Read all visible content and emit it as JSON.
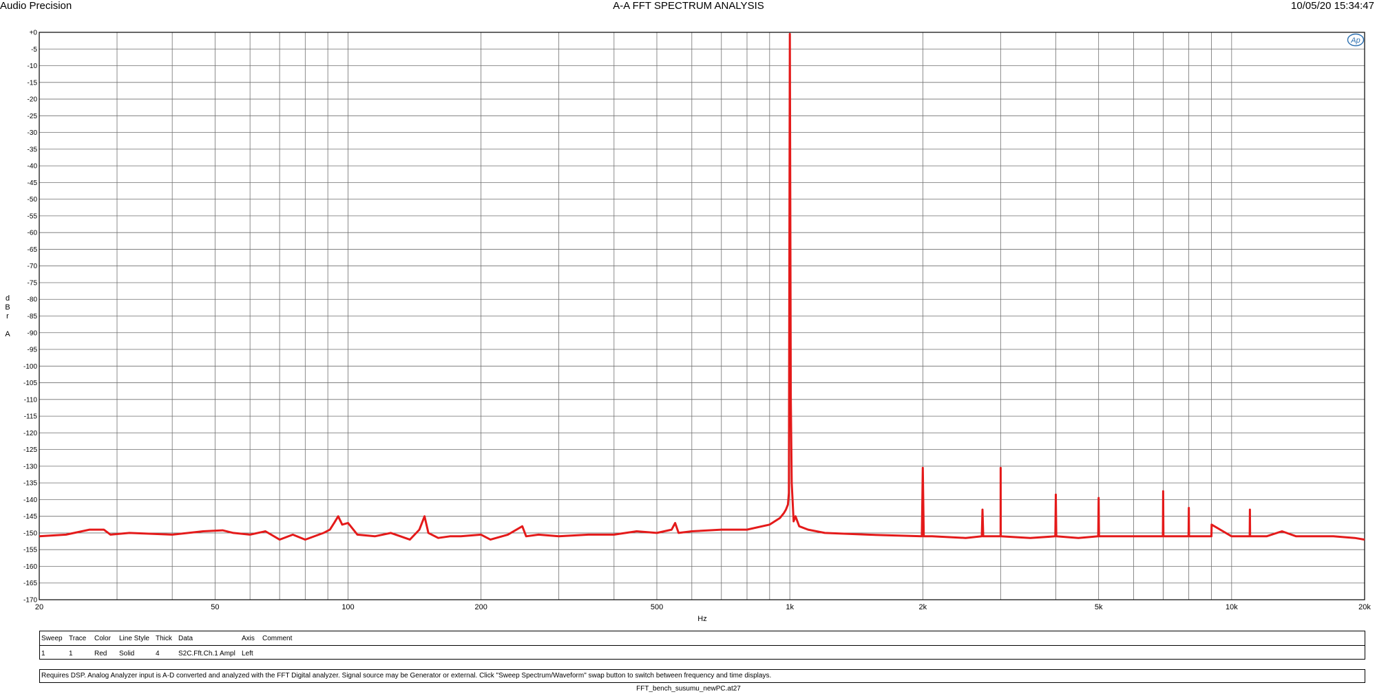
{
  "header": {
    "left": "Audio Precision",
    "center": "A-A FFT SPECTRUM ANALYSIS",
    "right": "10/05/20 15:34:47"
  },
  "chart_data": {
    "type": "line",
    "xscale": "log",
    "xlim": [
      20,
      20000
    ],
    "ylim": [
      -170,
      0
    ],
    "xlabel": "Hz",
    "ylabel": [
      "d",
      "B",
      "r",
      "",
      "A"
    ],
    "grid": true,
    "xticks": [
      {
        "v": 20,
        "t": "20"
      },
      {
        "v": 50,
        "t": "50"
      },
      {
        "v": 100,
        "t": "100"
      },
      {
        "v": 200,
        "t": "200"
      },
      {
        "v": 500,
        "t": "500"
      },
      {
        "v": 1000,
        "t": "1k"
      },
      {
        "v": 2000,
        "t": "2k"
      },
      {
        "v": 5000,
        "t": "5k"
      },
      {
        "v": 10000,
        "t": "10k"
      },
      {
        "v": 20000,
        "t": "20k"
      }
    ],
    "yticks": [
      "+0",
      "-5",
      "-10",
      "-15",
      "-20",
      "-25",
      "-30",
      "-35",
      "-40",
      "-45",
      "-50",
      "-55",
      "-60",
      "-65",
      "-70",
      "-75",
      "-80",
      "-85",
      "-90",
      "-95",
      "-100",
      "-105",
      "-110",
      "-115",
      "-120",
      "-125",
      "-130",
      "-135",
      "-140",
      "-145",
      "-150",
      "-155",
      "-160",
      "-165",
      "-170"
    ],
    "series": [
      {
        "color": "#e41a1a",
        "x": [
          20,
          23,
          26,
          28,
          29,
          32,
          40,
          47,
          52,
          55,
          60,
          65,
          70,
          75,
          80,
          88,
          91,
          93,
          95,
          97,
          100,
          105,
          115,
          125,
          138,
          145,
          149,
          152,
          160,
          170,
          180,
          200,
          210,
          230,
          248,
          253,
          270,
          300,
          350,
          400,
          450,
          500,
          540,
          550,
          560,
          600,
          700,
          800,
          900,
          950,
          970,
          980,
          990,
          995,
          1000,
          1005,
          1010,
          1020,
          1030,
          1050,
          1100,
          1200,
          1500,
          1990,
          2000,
          2010,
          2100,
          2500,
          2720,
          2730,
          2740,
          3000,
          3001,
          3002,
          3500,
          3990,
          4000,
          4010,
          4500,
          4990,
          5000,
          5010,
          5500,
          6000,
          6990,
          7000,
          7010,
          7500,
          7990,
          8000,
          8010,
          9000,
          9010,
          10000,
          10990,
          11000,
          11010,
          12000,
          13000,
          14000,
          17000,
          19000,
          20000
        ],
        "y": [
          -151,
          -150.5,
          -149,
          -149,
          -150.5,
          -150,
          -150.5,
          -149.5,
          -149.2,
          -150,
          -150.5,
          -149.5,
          -152,
          -150.5,
          -152,
          -150,
          -149,
          -147,
          -145,
          -147.5,
          -147,
          -150.5,
          -151,
          -150,
          -152,
          -149,
          -145,
          -150,
          -151.5,
          -151,
          -151,
          -150.5,
          -152,
          -150.5,
          -148,
          -151,
          -150.5,
          -151,
          -150.5,
          -150.5,
          -149.5,
          -150,
          -149,
          -147,
          -150,
          -149.5,
          -149,
          -149,
          -147.5,
          -145.5,
          -144,
          -143,
          -141.5,
          -138,
          -0.5,
          -110,
          -135,
          -146.5,
          -145,
          -148,
          -149,
          -150,
          -150.5,
          -151,
          -130.5,
          -151,
          -151,
          -151.5,
          -151,
          -143,
          -151,
          -151,
          -130.5,
          -151,
          -151.5,
          -151,
          -138.5,
          -151,
          -151.5,
          -151,
          -139.5,
          -151,
          -151,
          -151,
          -151,
          -137.5,
          -151,
          -151,
          -151,
          -142.5,
          -151,
          -151,
          -147.5,
          -151,
          -151,
          -143,
          -151,
          -151,
          -149.5,
          -151,
          -151,
          -151.5,
          -152
        ]
      }
    ]
  },
  "legend": {
    "headers": [
      "Sweep",
      "Trace",
      "Color",
      "Line Style",
      "Thick",
      "Data",
      "Axis",
      "Comment"
    ],
    "row": [
      "1",
      "1",
      "Red",
      "Solid",
      "4",
      "S2C.Fft.Ch.1 Ampl",
      "Left",
      ""
    ]
  },
  "note": "Requires DSP.  Analog Analyzer input is A-D converted and analyzed with the FFT Digital analyzer.  Signal source may be Generator or external.  Click \"Sweep Spectrum/Waveform\" swap button to switch between frequency and time displays.",
  "footer": "FFT_bench_susumu_newPC.at27",
  "logo": "Ap"
}
